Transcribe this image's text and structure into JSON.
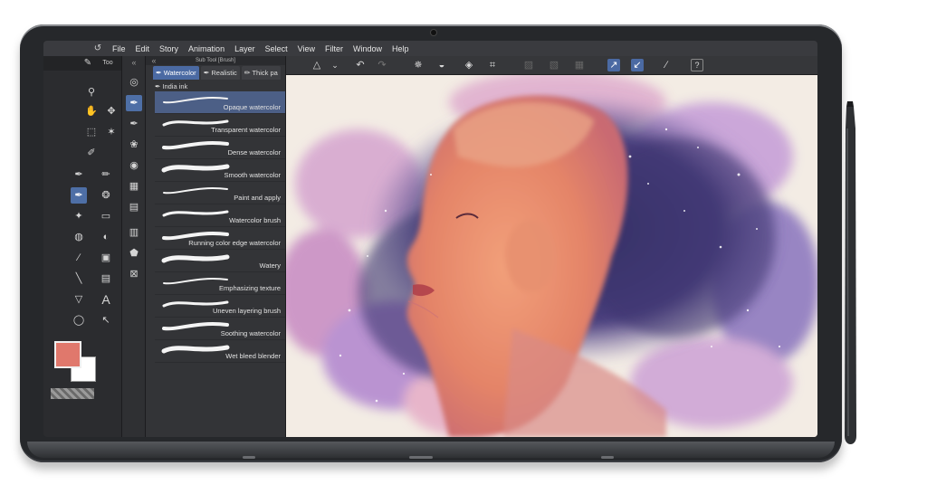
{
  "menu": [
    "File",
    "Edit",
    "Story",
    "Animation",
    "Layer",
    "Select",
    "View",
    "Filter",
    "Window",
    "Help"
  ],
  "subtool": {
    "title": "Sub Tool [Brush]",
    "tabs": [
      "Watercolor",
      "Realistic",
      "Thick pa"
    ],
    "group": "India ink",
    "brushes": [
      "Opaque watercolor",
      "Transparent watercolor",
      "Dense watercolor",
      "Smooth watercolor",
      "Paint and apply",
      "Watercolor brush",
      "Running color edge watercolor",
      "Watery",
      "Emphasizing texture",
      "Uneven layering brush",
      "Soothing watercolor",
      "Wet bleed blender"
    ],
    "selected": "Opaque watercolor"
  },
  "colors": {
    "main": "#e0786c",
    "sub": "#ffffff",
    "accent": "#4b6aa3"
  },
  "icons": {
    "tools": [
      "zoom-icon",
      "hand-icon",
      "move-layer-icon",
      "move-icon",
      "selection-icon",
      "magic-icon",
      "eyedropper-icon",
      "pen-icon",
      "pencil-icon",
      "brush-icon",
      "airbrush-icon",
      "eraser-icon",
      "blend-icon",
      "fill-icon",
      "gradient-icon",
      "shape-icon",
      "frame-icon",
      "ruler-icon",
      "text-icon",
      "lasso-icon",
      "operation-icon"
    ],
    "command_bar": [
      "flip-icon",
      "chevron-down-icon",
      "undo-icon",
      "redo-icon",
      "loading-icon",
      "fill-bucket-icon",
      "transform-icon",
      "crop-icon",
      "shade-icon",
      "stroke-icon",
      "pen-pressure-icon",
      "pen-tilt-icon",
      "line-icon",
      "help-icon"
    ]
  }
}
